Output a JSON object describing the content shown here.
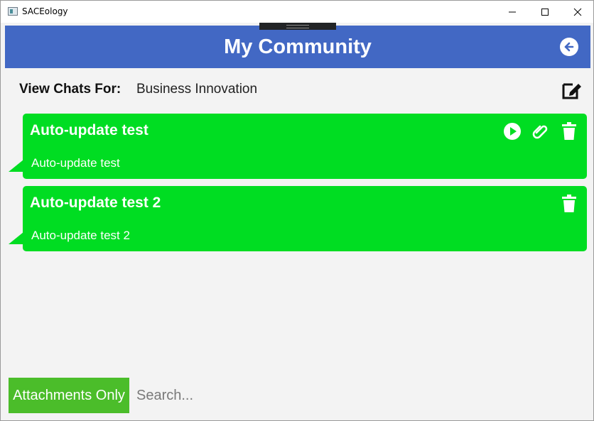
{
  "window": {
    "title": "SACEology",
    "controls": [
      "minimize",
      "maximize",
      "close"
    ]
  },
  "header": {
    "title": "My Community",
    "back_icon": "arrow-left-circle-icon",
    "background": "#4268c4"
  },
  "filter": {
    "label": "View Chats For:",
    "value": "Business Innovation",
    "edit_icon": "edit-icon"
  },
  "chats": [
    {
      "title": "Auto-update test",
      "body": "Auto-update test",
      "actions": [
        "play-icon",
        "paperclip-icon",
        "trash-icon"
      ]
    },
    {
      "title": "Auto-update test 2",
      "body": "Auto-update test 2",
      "actions": [
        "trash-icon"
      ]
    }
  ],
  "footer": {
    "attachments_label": "Attachments Only",
    "search_placeholder": "Search..."
  },
  "colors": {
    "chat_bubble": "#00dd22",
    "attachments_button": "#4bbd2a",
    "background": "#f3f3f3"
  }
}
